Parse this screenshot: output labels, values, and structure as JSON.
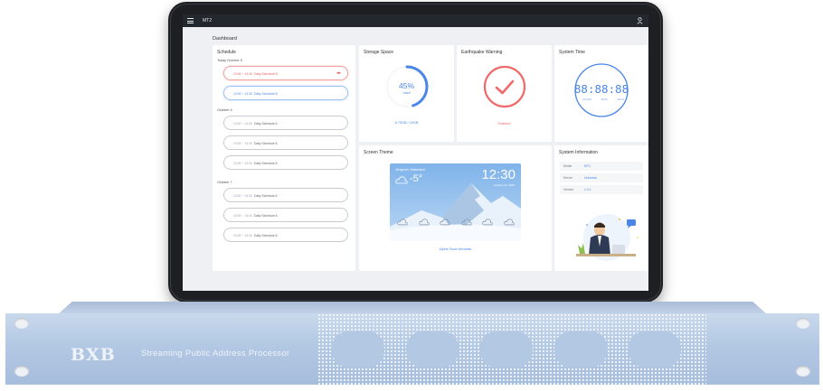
{
  "app": {
    "title": "MT2"
  },
  "page": {
    "title": "Dashboard"
  },
  "schedule": {
    "title": "Schedule",
    "groups": [
      {
        "day": "Today October 5",
        "items": [
          {
            "time": "13:00 ~ 13:30",
            "name": "Daily Schedule B",
            "state": "active-red"
          },
          {
            "time": "13:00 ~ 13:30",
            "name": "Daily Schedule B",
            "state": "active-blue"
          }
        ]
      },
      {
        "day": "October 6",
        "items": [
          {
            "time": "13:00 ~ 13:30",
            "name": "Daily Schedule A"
          },
          {
            "time": "13:00 ~ 13:30",
            "name": "Daily Schedule A"
          },
          {
            "time": "13:00 ~ 13:30",
            "name": "Daily Schedule A"
          }
        ]
      },
      {
        "day": "October 7",
        "items": [
          {
            "time": "13:00 ~ 13:30",
            "name": "Daily Schedule A"
          },
          {
            "time": "13:00 ~ 13:30",
            "name": "Daily Schedule A"
          },
          {
            "time": "13:00 ~ 13:30",
            "name": "Daily Schedule A"
          }
        ]
      }
    ]
  },
  "storage": {
    "title": "Storage Space",
    "percent": "45%",
    "percent_value": 45,
    "used_label": "Used",
    "detail": "8.75GB / 19GB"
  },
  "earthquake": {
    "title": "Earthquake Warning",
    "status": "Enabled",
    "color": "#ef6b6b"
  },
  "system_time": {
    "title": "System Time",
    "clock": "88:88:88",
    "labels": [
      "HOURS",
      "MINS",
      "SECS"
    ],
    "color": "#4a86e8"
  },
  "theme": {
    "title": "Screen Theme",
    "location": "Jiningmen, Switzerland",
    "temperature": "-5°",
    "time": "12:30",
    "date": "January 01, 2026",
    "forecast_count": 6,
    "caption": "Alpine Snow Mountain"
  },
  "system_info": {
    "title": "System Information",
    "rows": [
      {
        "key": "Model",
        "value": "MT2"
      },
      {
        "key": "Server",
        "value": "Unknown"
      },
      {
        "key": "Version",
        "value": "1.0.1"
      }
    ]
  },
  "device": {
    "brand": "BXB",
    "product": "Streaming Public Address Processor"
  },
  "colors": {
    "accent": "#4a86e8",
    "warning": "#ef6b6b",
    "rack": "#b3c8e3",
    "bezel": "#1d1f22"
  }
}
